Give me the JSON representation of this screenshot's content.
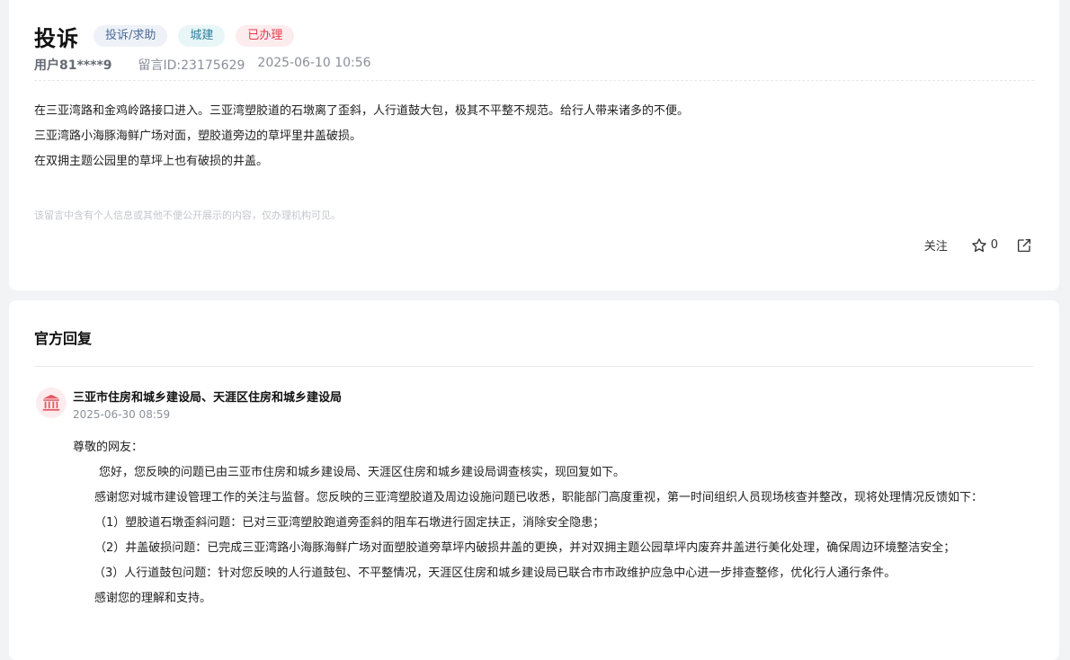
{
  "complaint": {
    "title": "投诉",
    "tags": [
      "投诉/求助",
      "城建",
      "已办理"
    ],
    "user": "用户81****9",
    "message_id": "留言ID:23175629",
    "datetime": "2025-06-10 10:56",
    "content": [
      "在三亚湾路和金鸡岭路接口进入。三亚湾塑胶道的石墩离了歪斜，人行道鼓大包，极其不平整不规范。给行人带来诸多的不便。",
      "三亚湾路小海豚海鲜广场对面，塑胶道旁边的草坪里井盖破损。",
      "在双拥主题公园里的草坪上也有破损的井盖。"
    ],
    "privacy_notice": "该留言中含有个人信息或其他不便公开展示的内容，仅办理机构可见。",
    "actions": {
      "follow_label": "关注",
      "star_count": "0",
      "star_icon": "star-outline-icon",
      "share_icon": "share-icon"
    }
  },
  "reply": {
    "section_title": "官方回复",
    "department_icon": "government-building-icon",
    "department": "三亚市住房和城乡建设局、天涯区住房和城乡建设局",
    "datetime": "2025-06-30 08:59",
    "body": [
      "尊敬的网友：",
      "您好，您反映的问题已由三亚市住房和城乡建设局、天涯区住房和城乡建设局调查核实，现回复如下。",
      "感谢您对城市建设管理工作的关注与监督。您反映的三亚湾塑胶道及周边设施问题已收悉，职能部门高度重视，第一时间组织人员现场核查并整改，现将处理情况反馈如下：",
      "（1）塑胶道石墩歪斜问题：已对三亚湾塑胶跑道旁歪斜的阻车石墩进行固定扶正，消除安全隐患；",
      "（2）井盖破损问题：已完成三亚湾路小海豚海鲜广场对面塑胶道旁草坪内破损井盖的更换，并对双拥主题公园草坪内废弃井盖进行美化处理，确保周边环境整洁安全；",
      "（3）人行道鼓包问题：针对您反映的人行道鼓包、不平整情况，天涯区住房和城乡建设局已联合市市政维护应急中心进一步排查整修，优化行人通行条件。",
      "感谢您的理解和支持。"
    ]
  },
  "colors": {
    "accent_red": "#e03b4a",
    "tag_blue_text": "#4a6a99",
    "tag_teal_text": "#2f7f9a",
    "background": "#f2f3f5"
  }
}
